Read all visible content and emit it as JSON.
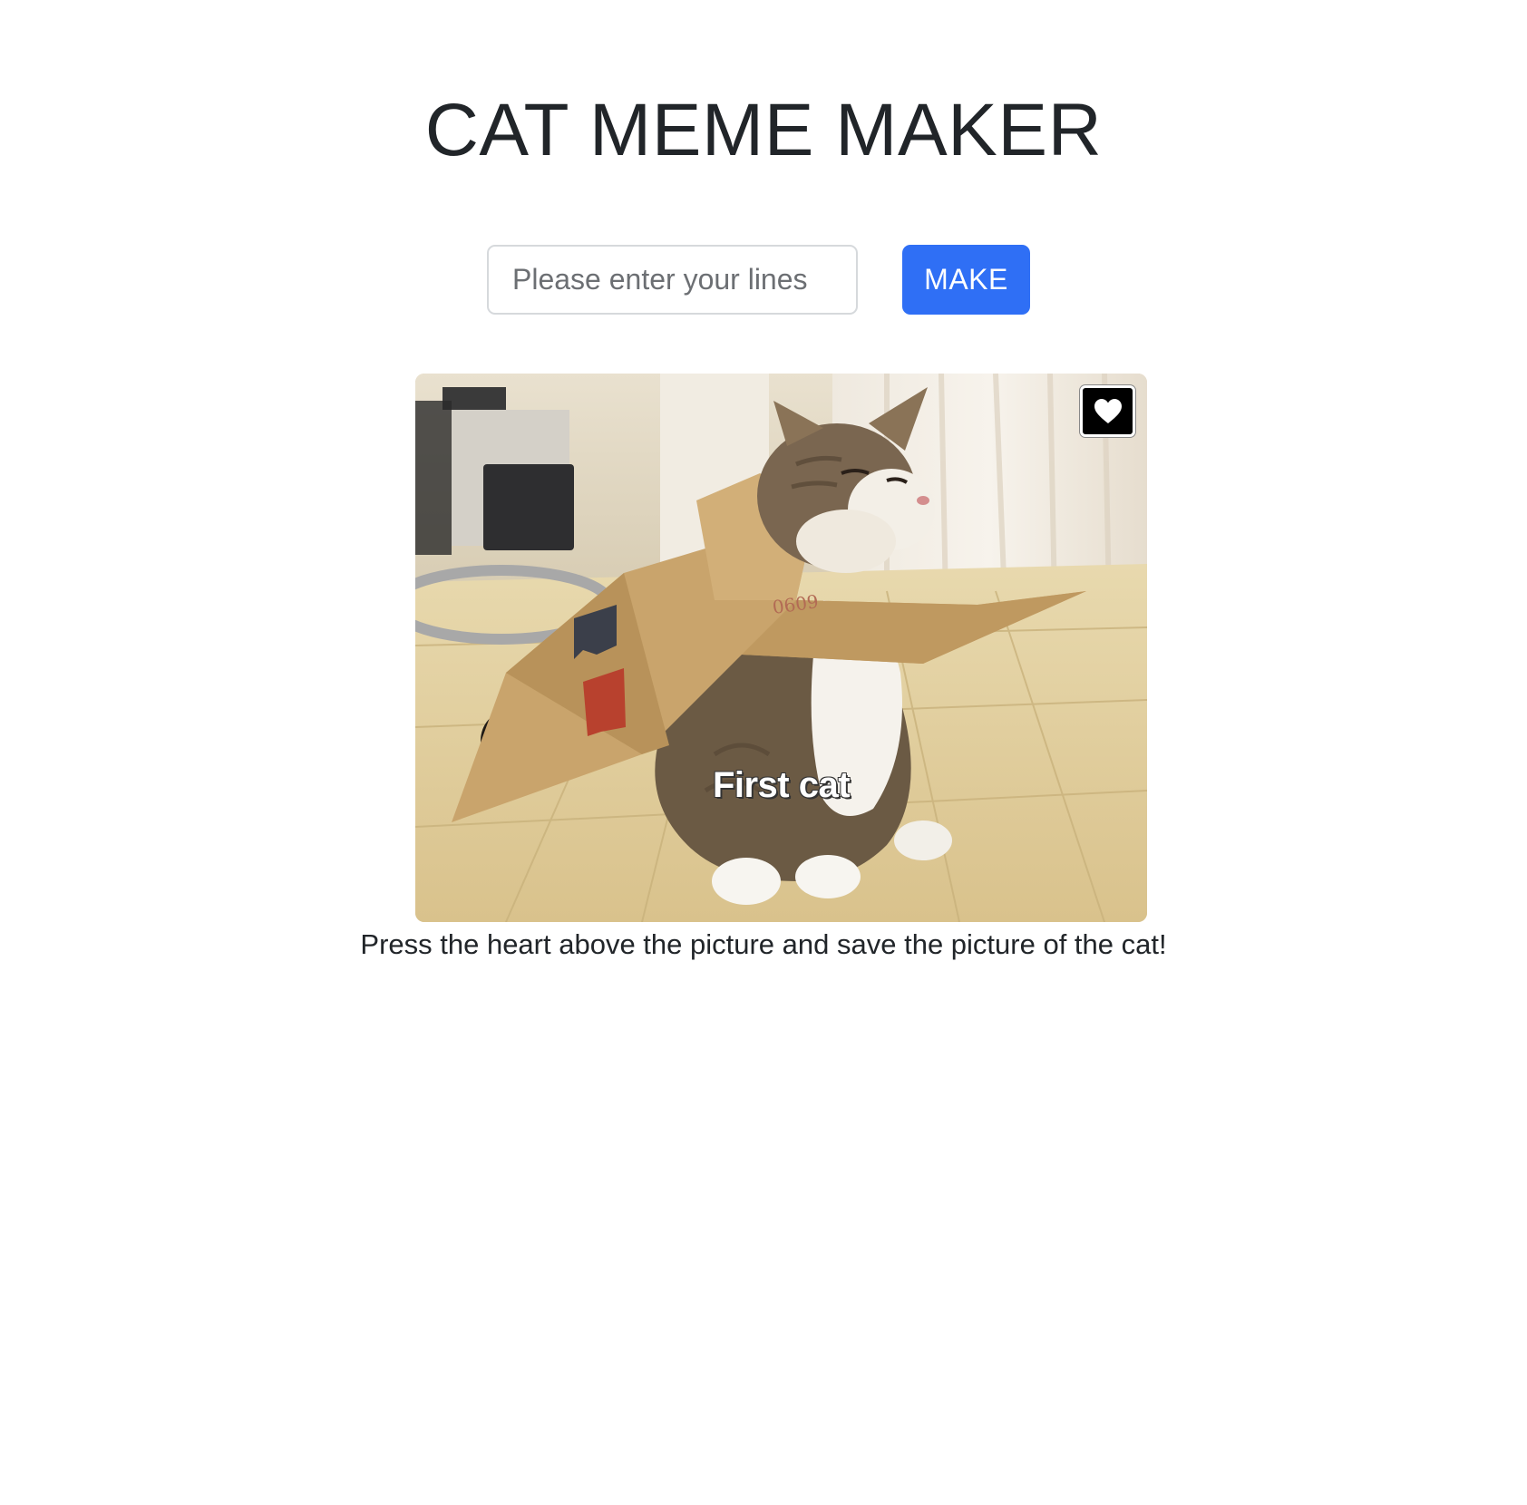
{
  "page": {
    "title": "CAT MEME MAKER"
  },
  "form": {
    "input_placeholder": "Please enter your lines",
    "input_value": "",
    "make_label": "MAKE"
  },
  "meme": {
    "caption": "First cat",
    "favorite_icon": "heart-icon"
  },
  "hint": {
    "text": "Press the heart above the picture and save the picture of the cat!"
  },
  "colors": {
    "primary": "#2f6ff5",
    "text": "#212529",
    "input_border": "#d6d9dc"
  }
}
